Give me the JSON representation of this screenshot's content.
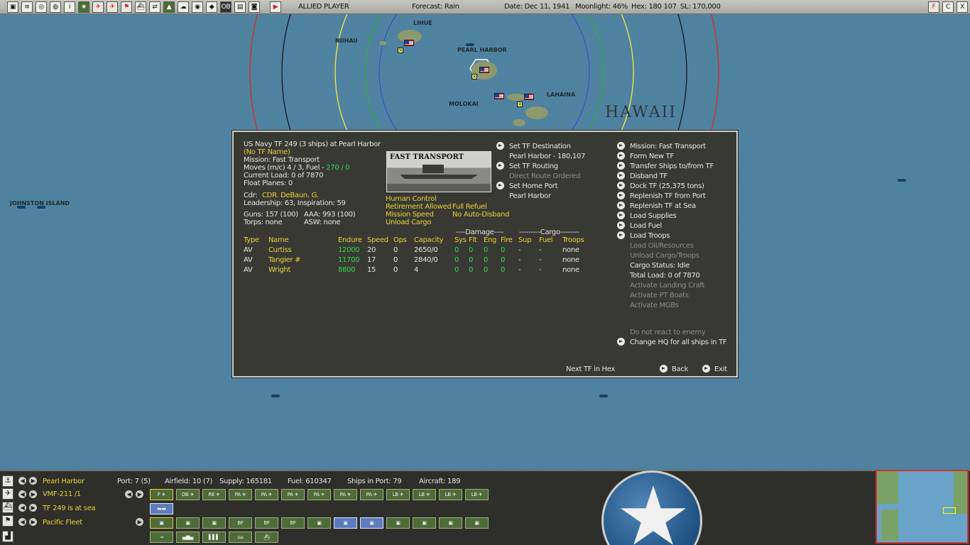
{
  "topbar": {
    "player": "ALLIED PLAYER",
    "forecast": "Forecast: Rain",
    "date": "Date: Dec 11, 1941",
    "moonlight": "Moonlight: 46%",
    "hex": "Hex: 180 107",
    "sl": "SL: 170,000",
    "right_buttons": [
      "F",
      "C",
      "X"
    ]
  },
  "map": {
    "places": [
      "LIHUE",
      "NIIHAU",
      "PEARL HARBOR",
      "MOLOKAI",
      "LAHAINA",
      "JOHNSTON ISLAND"
    ],
    "region": "HAWAII"
  },
  "tf": {
    "header": "US Navy TF 249 (3 ships) at Pearl Harbor",
    "name": "(No TF Name)",
    "mission": "Mission:  Fast Transport",
    "moves_label": "Moves (m/c)  4 / 3, Fuel - ",
    "fuel": "270 / 0",
    "current_load": "Current Load:  0 of 7870",
    "float_planes": "Float Planes:  0",
    "cdr_label": "Cdr:",
    "cdr": "CDR. DeBaun, G.",
    "leadership": "Leadership: 63, Inspiration: 59",
    "guns": "Guns: 157 (100)",
    "aaa": "AAA: 993 (100)",
    "torps": "Torps: none",
    "asw": "ASW: none",
    "photo_caption": "FAST TRANSPORT",
    "control": "Human Control",
    "retirement": "Retirement Allowed",
    "refuel": "Full Refuel",
    "speed": "Mission Speed",
    "disband": "No Auto-Disband",
    "unload": "Unload Cargo",
    "middle_menu": [
      {
        "label": "Set TF Destination",
        "bullet": true,
        "dim": false
      },
      {
        "label": "Pearl Harbor - 180,107",
        "bullet": false,
        "dim": false
      },
      {
        "label": "Set TF Routing",
        "bullet": true,
        "dim": false
      },
      {
        "label": "Direct Route Ordered",
        "bullet": false,
        "dim": true
      },
      {
        "label": "Set Home Port",
        "bullet": true,
        "dim": false
      },
      {
        "label": "Pearl Harbor",
        "bullet": false,
        "dim": false
      }
    ],
    "right_menu": [
      {
        "label": "Mission: Fast Transport",
        "bullet": true,
        "dim": false
      },
      {
        "label": "Form New TF",
        "bullet": true,
        "dim": false
      },
      {
        "label": "Transfer Ships to/from TF",
        "bullet": true,
        "dim": false
      },
      {
        "label": "Disband TF",
        "bullet": true,
        "dim": false
      },
      {
        "label": "Dock TF (25,375 tons)",
        "bullet": true,
        "dim": false
      },
      {
        "label": "Replenish TF from Port",
        "bullet": true,
        "dim": false
      },
      {
        "label": "Replenish TF at Sea",
        "bullet": true,
        "dim": false
      },
      {
        "label": "Load Supplies",
        "bullet": true,
        "dim": false
      },
      {
        "label": "Load Fuel",
        "bullet": true,
        "dim": false
      },
      {
        "label": "Load Troops",
        "bullet": true,
        "dim": false
      },
      {
        "label": "Load Oil/Resources",
        "bullet": false,
        "dim": true
      },
      {
        "label": "Unload Cargo/Troops",
        "bullet": false,
        "dim": true
      },
      {
        "label": "Cargo Status: Idle",
        "bullet": false,
        "dim": false
      },
      {
        "label": "Total Load: 0 of 7870",
        "bullet": false,
        "dim": false
      },
      {
        "label": "Activate Landing Craft",
        "bullet": false,
        "dim": true
      },
      {
        "label": "Activate PT Boats",
        "bullet": false,
        "dim": true
      },
      {
        "label": "Activate MGBs",
        "bullet": false,
        "dim": true
      }
    ],
    "do_not_react": "Do not react to enemy",
    "change_hq": "Change HQ for all ships in TF",
    "next_tf": "Next TF in Hex",
    "back": "Back",
    "exit": "Exit",
    "damage_header": "----Damage----",
    "cargo_header": "---------Cargo--------",
    "columns": [
      "Type",
      "Name",
      "Endure",
      "Speed",
      "Ops",
      "Capacity",
      "Sys",
      "Flt",
      "Eng",
      "Fire",
      "Sup",
      "Fuel",
      "Troops"
    ],
    "ships": [
      {
        "type": "AV",
        "name": "Curtiss",
        "endure": "12000",
        "speed": "20",
        "ops": "0",
        "capacity": "2650/0",
        "sys": "0",
        "flt": "0",
        "eng": "0",
        "fire": "0",
        "sup": "-",
        "fuel": "-",
        "troops": "none"
      },
      {
        "type": "AV",
        "name": "Tangier #",
        "endure": "11700",
        "speed": "17",
        "ops": "0",
        "capacity": "2840/0",
        "sys": "0",
        "flt": "0",
        "eng": "0",
        "fire": "0",
        "sup": "-",
        "fuel": "-",
        "troops": "none"
      },
      {
        "type": "AV",
        "name": "Wright",
        "endure": "8800",
        "speed": "15",
        "ops": "0",
        "capacity": "4",
        "sys": "0",
        "flt": "0",
        "eng": "0",
        "fire": "0",
        "sup": "-",
        "fuel": "-",
        "troops": "none"
      }
    ]
  },
  "bottom": {
    "base": "Pearl Harbor",
    "port": "Port: 7 (5)",
    "airfield": "Airfield: 10 (7)",
    "supply": "Supply: 165181",
    "fuel": "Fuel: 610347",
    "ships_in_port": "Ships in Port: 79",
    "aircraft": "Aircraft: 189",
    "air_unit": "VMF-211 /1",
    "tf_status": "TF 249 is at sea",
    "hq": "Pacific Fleet",
    "air_slots": [
      "F",
      "DB",
      "RE",
      "PA",
      "PA",
      "PA",
      "PA",
      "PA",
      "PA",
      "LB",
      "LB",
      "LB",
      "LB"
    ],
    "hq_slots": [
      "",
      "",
      "",
      "BF",
      "BF",
      "BF",
      "",
      "",
      "",
      "",
      "",
      "",
      ""
    ]
  }
}
